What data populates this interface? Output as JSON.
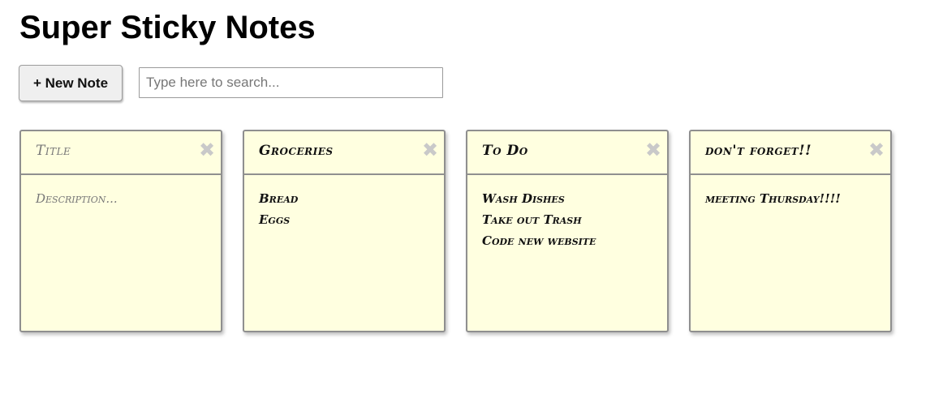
{
  "app": {
    "title": "Super Sticky Notes"
  },
  "toolbar": {
    "new_note_label": "+ New Note",
    "search_placeholder": "Type here to search...",
    "search_value": ""
  },
  "notes": [
    {
      "title": "",
      "title_placeholder": "Title",
      "description": "",
      "description_placeholder": "Description...",
      "delete_glyph": "✖"
    },
    {
      "title": "Groceries",
      "description": "Bread\nEggs",
      "delete_glyph": "✖"
    },
    {
      "title": "To Do",
      "description": "Wash Dishes\nTake out Trash\nCode new website",
      "delete_glyph": "✖"
    },
    {
      "title": "don't forget!!",
      "description": "meeting Thursday!!!!",
      "delete_glyph": "✖"
    }
  ],
  "colors": {
    "note_background": "#ffffe0",
    "note_border": "#8f8f8f",
    "delete_icon": "#c9c9c9",
    "button_background": "#efefef"
  }
}
